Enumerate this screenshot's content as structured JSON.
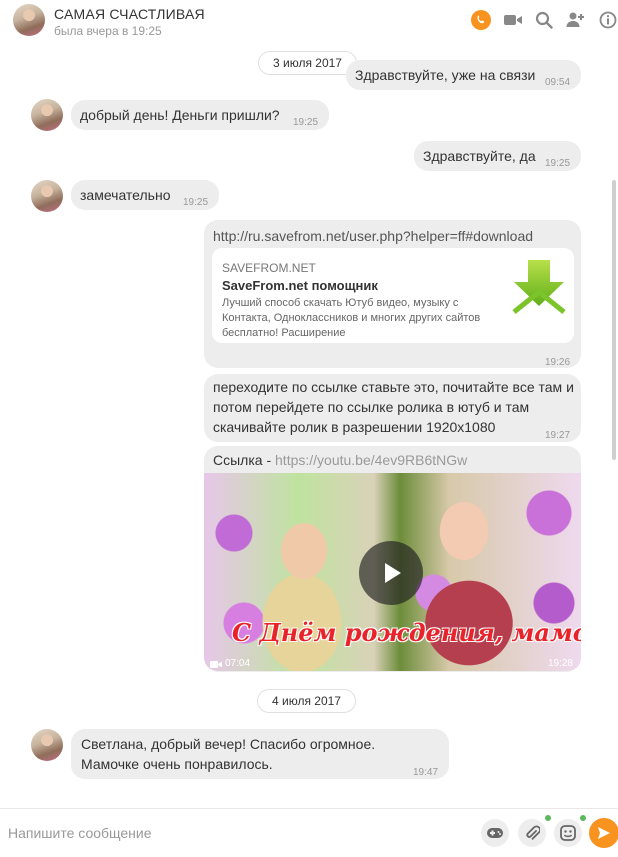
{
  "header": {
    "title": "САМАЯ СЧАСТЛИВАЯ",
    "subtitle": "была вчера в 19:25",
    "icons": [
      "call-icon",
      "video-call-icon",
      "search-icon",
      "add-user-icon",
      "info-icon"
    ],
    "accent_color": "#f7931e"
  },
  "dates": {
    "first": "3 июля 2017",
    "second": "4 июля 2017"
  },
  "messages": [
    {
      "text": "Здравствуйте, уже на связи",
      "time": "09:54"
    },
    {
      "text": "добрый день! Деньги пришли?",
      "time": "19:25"
    },
    {
      "text": "Здравствуйте, да",
      "time": "19:25"
    },
    {
      "text": "замечательно",
      "time": "19:25"
    },
    {
      "link": "http://ru.savefrom.net/user.php?helper=ff#download",
      "preview_site": "SAVEFROM.NET",
      "preview_title": "SaveFrom.net помощник",
      "preview_desc": "Лучший способ скачать Ютуб видео, музыку с Контакта, Одноклассников и многих других сайтов бесплатно! Расширение",
      "time": "19:26"
    },
    {
      "text": "переходите по ссылке ставьте это, почитайте все там и потом перейдете по ссылке ролика в ютуб и там скачивайте ролик в разрешении 1920х1080",
      "time": "19:27"
    },
    {
      "prefix": "Ссылка - ",
      "link": "https://youtu.be/4ev9RB6tNGw",
      "video_caption": "С Днём рождения, мамочка!",
      "duration": "07:04",
      "time": "19:28"
    },
    {
      "text_line1": "Светлана, добрый вечер! Спасибо огромное.",
      "text_line2": "Мамочке очень понравилось.",
      "time": "19:47"
    }
  ],
  "input": {
    "placeholder": "Напишите сообщение",
    "icons": [
      "gamepad-icon",
      "attach-icon",
      "emoji-icon",
      "send-icon"
    ]
  }
}
